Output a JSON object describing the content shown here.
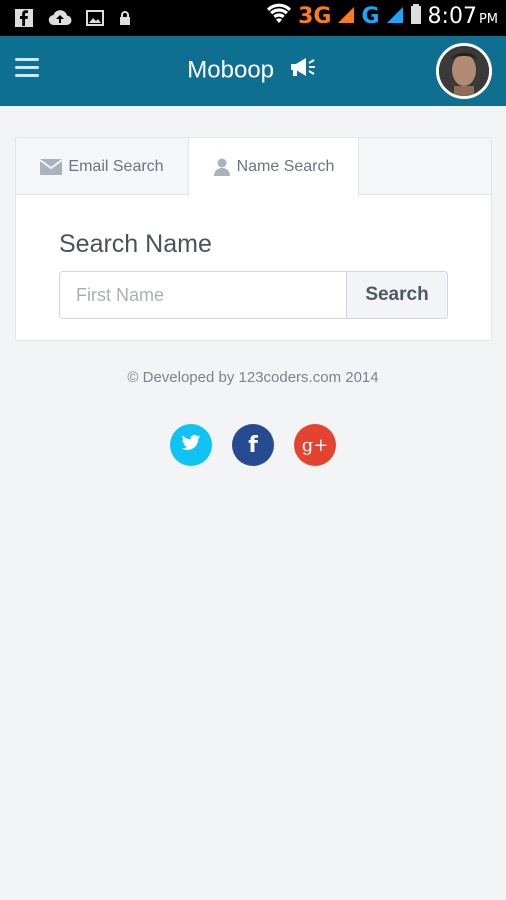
{
  "status_bar": {
    "network_3g": "3G",
    "network_g": "G",
    "time": "8:07",
    "ampm": "PM"
  },
  "header": {
    "title": "Moboop"
  },
  "tabs": [
    {
      "label": "Email Search",
      "icon": "envelope-icon"
    },
    {
      "label": "Name Search",
      "icon": "user-icon",
      "active": true
    }
  ],
  "search": {
    "heading": "Search Name",
    "placeholder": "First Name",
    "value": "",
    "button_label": "Search"
  },
  "footer": {
    "text": "© Developed by 123coders.com 2014",
    "social": [
      {
        "name": "twitter",
        "color": "#0fc3f3"
      },
      {
        "name": "facebook",
        "color": "#274b93",
        "glyph": "f"
      },
      {
        "name": "google-plus",
        "color": "#e2442f",
        "glyph": "g+"
      }
    ]
  },
  "colors": {
    "header_bg": "#0f6f90",
    "page_bg": "#f3f4f6"
  }
}
